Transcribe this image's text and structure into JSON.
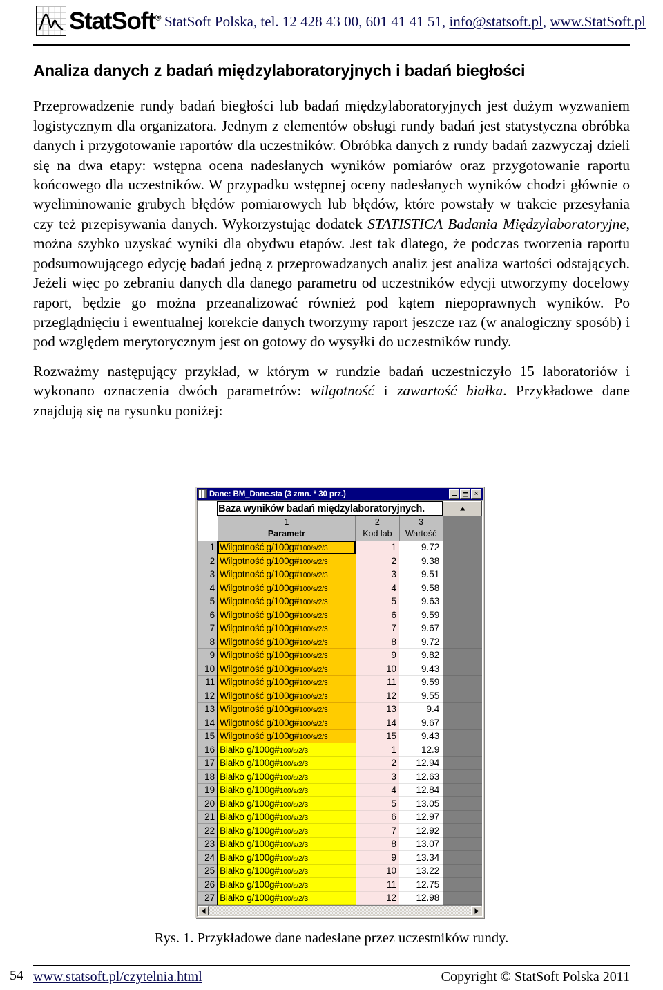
{
  "header": {
    "logo_text": "StatSoft",
    "logo_reg": "®",
    "contact_prefix": "StatSoft Polska, tel. 12 428 43 00, 601 41 41 51, ",
    "email": "info@statsoft.pl",
    "contact_sep": ", ",
    "website": "www.StatSoft.pl"
  },
  "document": {
    "title": "Analiza danych z badań międzylaboratoryjnych i badań biegłości",
    "paragraph_1_a": "Przeprowadzenie rundy badań biegłości lub badań międzylaboratoryjnych jest dużym wyzwaniem logistycznym dla organizatora. Jednym z elementów obsługi rundy badań jest statystyczna obróbka danych i przygotowanie raportów dla uczestników. Obróbka danych z rundy badań zazwyczaj dzieli się na dwa etapy: wstępna ocena nadesłanych wyników pomiarów oraz przygotowanie raportu końcowego dla uczestników. W przypadku wstępnej oceny nadesłanych wyników chodzi głównie o wyeliminowanie grubych błędów pomiarowych lub błędów, które powstały w trakcie przesyłania czy też przepisywania danych. Wykorzystując dodatek ",
    "paragraph_1_italic": "STATISTICA Badania Międzylaboratoryjne",
    "paragraph_1_b": ", można szybko uzyskać wyniki dla obydwu etapów. Jest tak dlatego, że podczas tworzenia raportu podsumowującego edycję badań jedną z przeprowadzanych analiz jest analiza wartości odstających. Jeżeli więc po zebraniu danych dla danego parametru od uczestników edycji utworzymy docelowy raport, będzie go można przeanalizować również pod kątem niepoprawnych wyników. Po przeglądnięciu i ewentualnej korekcie danych tworzymy raport jeszcze raz (w analogiczny sposób) i pod względem merytorycznym jest on gotowy do wysyłki do uczestników rundy.",
    "paragraph_2_a": "Rozważmy następujący przykład, w którym w rundzie badań uczestniczyło 15 laboratoriów i wykonano oznaczenia dwóch parametrów: ",
    "paragraph_2_italic_1": "wilgotność",
    "paragraph_2_mid": " i ",
    "paragraph_2_italic_2": "zawartość białka",
    "paragraph_2_b": ". Przykładowe dane znajdują się na rysunku poniżej:",
    "figure_caption": "Rys. 1. Przykładowe dane nadesłane przez uczestników rundy."
  },
  "spreadsheet": {
    "window_title": "Dane: BM_Dane.sta (3 zmn. * 30 prz.)",
    "title_icon": "spreadsheet-icon",
    "buttons": {
      "minimize": "minimize-icon",
      "maximize": "maximize-icon",
      "close": "×"
    },
    "banner": "Baza wyników badań międzylaboratoryjnych.",
    "columns": [
      {
        "num": "1",
        "name": "Parametr"
      },
      {
        "num": "2",
        "name": "Kod lab"
      },
      {
        "num": "3",
        "name": "Wartość"
      }
    ],
    "param_wilgotnosc": "Wilgotność g/100g#",
    "param_bialko": "Białko g/100g#",
    "param_unit_suffix": "100/s/2/3",
    "rows": [
      {
        "n": "1",
        "grp": "a",
        "param": "Wilgotność g/100g#",
        "unit": "100/s/2/3",
        "kod": "1",
        "wart": "9.72",
        "selected": true
      },
      {
        "n": "2",
        "grp": "a",
        "param": "Wilgotność g/100g#",
        "unit": "100/s/2/3",
        "kod": "2",
        "wart": "9.38"
      },
      {
        "n": "3",
        "grp": "a",
        "param": "Wilgotność g/100g#",
        "unit": "100/s/2/3",
        "kod": "3",
        "wart": "9.51"
      },
      {
        "n": "4",
        "grp": "a",
        "param": "Wilgotność g/100g#",
        "unit": "100/s/2/3",
        "kod": "4",
        "wart": "9.58"
      },
      {
        "n": "5",
        "grp": "a",
        "param": "Wilgotność g/100g#",
        "unit": "100/s/2/3",
        "kod": "5",
        "wart": "9.63"
      },
      {
        "n": "6",
        "grp": "a",
        "param": "Wilgotność g/100g#",
        "unit": "100/s/2/3",
        "kod": "6",
        "wart": "9.59"
      },
      {
        "n": "7",
        "grp": "a",
        "param": "Wilgotność g/100g#",
        "unit": "100/s/2/3",
        "kod": "7",
        "wart": "9.67"
      },
      {
        "n": "8",
        "grp": "a",
        "param": "Wilgotność g/100g#",
        "unit": "100/s/2/3",
        "kod": "8",
        "wart": "9.72"
      },
      {
        "n": "9",
        "grp": "a",
        "param": "Wilgotność g/100g#",
        "unit": "100/s/2/3",
        "kod": "9",
        "wart": "9.82"
      },
      {
        "n": "10",
        "grp": "a",
        "param": "Wilgotność g/100g#",
        "unit": "100/s/2/3",
        "kod": "10",
        "wart": "9.43"
      },
      {
        "n": "11",
        "grp": "a",
        "param": "Wilgotność g/100g#",
        "unit": "100/s/2/3",
        "kod": "11",
        "wart": "9.59"
      },
      {
        "n": "12",
        "grp": "a",
        "param": "Wilgotność g/100g#",
        "unit": "100/s/2/3",
        "kod": "12",
        "wart": "9.55"
      },
      {
        "n": "13",
        "grp": "a",
        "param": "Wilgotność g/100g#",
        "unit": "100/s/2/3",
        "kod": "13",
        "wart": "9.4"
      },
      {
        "n": "14",
        "grp": "a",
        "param": "Wilgotność g/100g#",
        "unit": "100/s/2/3",
        "kod": "14",
        "wart": "9.67"
      },
      {
        "n": "15",
        "grp": "a",
        "param": "Wilgotność g/100g#",
        "unit": "100/s/2/3",
        "kod": "15",
        "wart": "9.43"
      },
      {
        "n": "16",
        "grp": "b",
        "param": "Białko g/100g#",
        "unit": "100/s/2/3",
        "kod": "1",
        "wart": "12.9"
      },
      {
        "n": "17",
        "grp": "b",
        "param": "Białko g/100g#",
        "unit": "100/s/2/3",
        "kod": "2",
        "wart": "12.94"
      },
      {
        "n": "18",
        "grp": "b",
        "param": "Białko g/100g#",
        "unit": "100/s/2/3",
        "kod": "3",
        "wart": "12.63"
      },
      {
        "n": "19",
        "grp": "b",
        "param": "Białko g/100g#",
        "unit": "100/s/2/3",
        "kod": "4",
        "wart": "12.84"
      },
      {
        "n": "20",
        "grp": "b",
        "param": "Białko g/100g#",
        "unit": "100/s/2/3",
        "kod": "5",
        "wart": "13.05"
      },
      {
        "n": "21",
        "grp": "b",
        "param": "Białko g/100g#",
        "unit": "100/s/2/3",
        "kod": "6",
        "wart": "12.97"
      },
      {
        "n": "22",
        "grp": "b",
        "param": "Białko g/100g#",
        "unit": "100/s/2/3",
        "kod": "7",
        "wart": "12.92"
      },
      {
        "n": "23",
        "grp": "b",
        "param": "Białko g/100g#",
        "unit": "100/s/2/3",
        "kod": "8",
        "wart": "13.07"
      },
      {
        "n": "24",
        "grp": "b",
        "param": "Białko g/100g#",
        "unit": "100/s/2/3",
        "kod": "9",
        "wart": "13.34"
      },
      {
        "n": "25",
        "grp": "b",
        "param": "Białko g/100g#",
        "unit": "100/s/2/3",
        "kod": "10",
        "wart": "13.22"
      },
      {
        "n": "26",
        "grp": "b",
        "param": "Białko g/100g#",
        "unit": "100/s/2/3",
        "kod": "11",
        "wart": "12.75"
      },
      {
        "n": "27",
        "grp": "b",
        "param": "Białko g/100g#",
        "unit": "100/s/2/3",
        "kod": "12",
        "wart": "12.98"
      }
    ],
    "colors": {
      "titlebar": "#000080",
      "group_a_cell": "#ffcc00",
      "group_b_cell": "#ffff00",
      "kod_cell": "#fbe4e4",
      "header_cell": "#c0c0c0",
      "blank_col": "#808080"
    }
  },
  "footer": {
    "page_number": "54",
    "link": "www.statsoft.pl/czytelnia.html",
    "copyright": "Copyright © StatSoft Polska 2011"
  }
}
